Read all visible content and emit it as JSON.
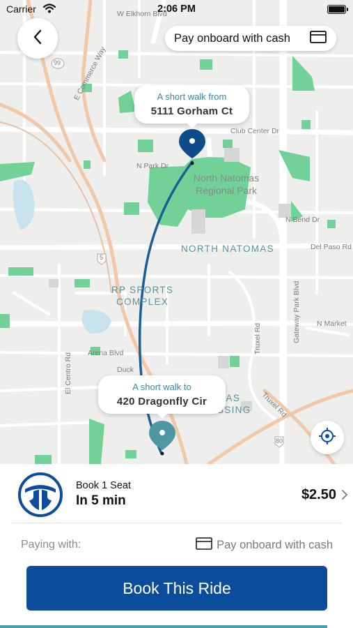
{
  "status_bar": {
    "carrier": "Carrier",
    "time": "2:06 PM"
  },
  "header": {
    "pay_pill_label": "Pay onboard with cash"
  },
  "map": {
    "street_labels": {
      "elkhorn": "W Elkhorn Blvd",
      "hwy99": "99",
      "commerce": "E Commerce Way",
      "club_center": "Club Center Dr",
      "n_park": "N Park Dr",
      "n_bend": "N Bend Dr",
      "del_paso": "Del Paso Rd",
      "hwy5": "5",
      "gateway": "Gateway Park Blvd",
      "truxel": "Truxel Rd",
      "truxel2": "Truxel Rd",
      "n_market": "N Market",
      "arena": "Arena Blvd",
      "el_centro": "El Centro Rd",
      "duck": "Duck",
      "hwy80": "80"
    },
    "park_label": "North Natomas\nRegional Park",
    "area_north_natomas": "NORTH NATOMAS",
    "area_rp_sports": "RP SPORTS\nCOMPLEX",
    "area_partial": "MAS\nSSING"
  },
  "pickup": {
    "caption": "A short walk from",
    "address": "5111 Gorham Ct"
  },
  "dropoff": {
    "caption": "A short walk to",
    "address": "420 Dragonfly Cir"
  },
  "ride": {
    "seat_label": "Book 1 Seat",
    "eta": "In 5 min",
    "price": "$2.50",
    "paying_label": "Paying with:",
    "payment_method": "Pay onboard with cash",
    "book_button": "Book This Ride"
  },
  "colors": {
    "brand_blue": "#0b4c9c",
    "route_blue": "#1a5e95",
    "dropoff_teal": "#4f97a2",
    "park_green": "#71d197",
    "bottom_accent": "#49a0a7"
  },
  "icons": {
    "back": "chevron-left-icon",
    "card": "credit-card-icon",
    "locate": "crosshair-icon",
    "pickup_pin": "map-pin-icon",
    "dropoff_pin": "map-pin-icon",
    "logo": "transit-logo-icon",
    "price_more": "chevron-right-icon"
  }
}
